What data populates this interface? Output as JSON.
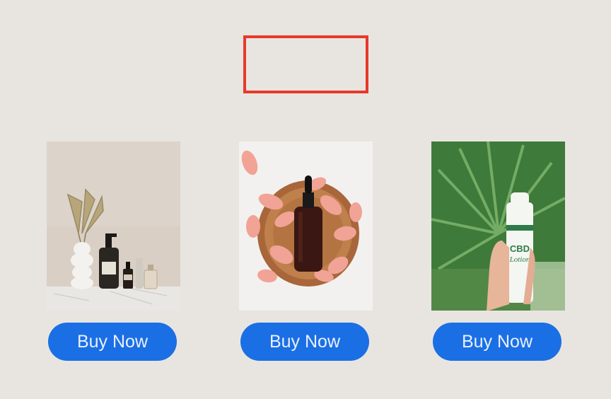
{
  "products": [
    {
      "image": "skincare-shelf-photo",
      "button_label": "Buy Now"
    },
    {
      "image": "serum-bottle-petals-photo",
      "button_label": "Buy Now"
    },
    {
      "image": "cbd-lotion-photo",
      "button_label": "Buy Now",
      "photo_text": {
        "brand": "CBD",
        "product": "Lotion"
      }
    }
  ],
  "colors": {
    "background": "#e8e5e1",
    "button": "#1b6fe4",
    "frame": "#e8392a"
  }
}
